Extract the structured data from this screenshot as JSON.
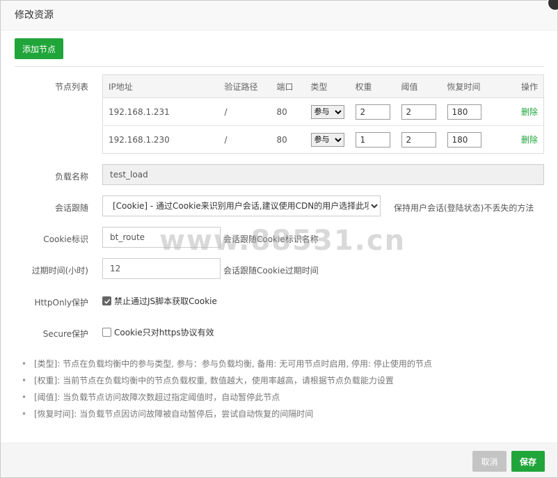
{
  "dialog": {
    "title": "修改资源"
  },
  "toolbar": {
    "add_node_label": "添加节点"
  },
  "form": {
    "nodes_label": "节点列表",
    "load_name_label": "负载名称",
    "load_name_value": "test_load",
    "session_label": "会话跟随",
    "session_selected": "[Cookie] - 通过Cookie来识别用户会话,建议使用CDN的用户选择此项",
    "session_hint": "保持用户会话(登陆状态)不丢失的方法",
    "cookie_label": "Cookie标识",
    "cookie_value": "bt_route",
    "cookie_hint": "会话跟随Cookie标识名称",
    "expire_label": "过期时间(小时)",
    "expire_value": "12",
    "expire_hint": "会话跟随Cookie过期时间",
    "httponly_label": "HttpOnly保护",
    "httponly_text": "禁止通过JS脚本获取Cookie",
    "secure_label": "Secure保护",
    "secure_text": "Cookie只对https协议有效"
  },
  "table": {
    "headers": [
      "IP地址",
      "验证路径",
      "端口",
      "类型",
      "权重",
      "阈值",
      "恢复时间",
      "操作"
    ],
    "rows": [
      {
        "ip": "192.168.1.231",
        "path": "/",
        "port": "80",
        "type": "参与",
        "weight": "2",
        "threshold": "2",
        "recover": "180",
        "action": "删除"
      },
      {
        "ip": "192.168.1.230",
        "path": "/",
        "port": "80",
        "type": "参与",
        "weight": "1",
        "threshold": "2",
        "recover": "180",
        "action": "删除"
      }
    ]
  },
  "notes": [
    "[类型]: 节点在负载均衡中的参与类型, 参与：参与负载均衡, 备用: 无可用节点时启用, 停用: 停止使用的节点",
    "[权重]: 当前节点在负载均衡中的节点负载权重, 数值越大，使用率越高，请根据节点负载能力设置",
    "[阈值]: 当负载节点访问故障次数超过指定阈值时，自动暂停此节点",
    "[恢复时间]: 当负载节点因访问故障被自动暂停后，尝试自动恢复的间隔时间"
  ],
  "watermark": "www.88531.cn",
  "footer": {
    "cancel_label": "取消",
    "save_label": "保存"
  },
  "colors": {
    "accent": "#20a53a",
    "cancel": "#c4c4c4"
  }
}
